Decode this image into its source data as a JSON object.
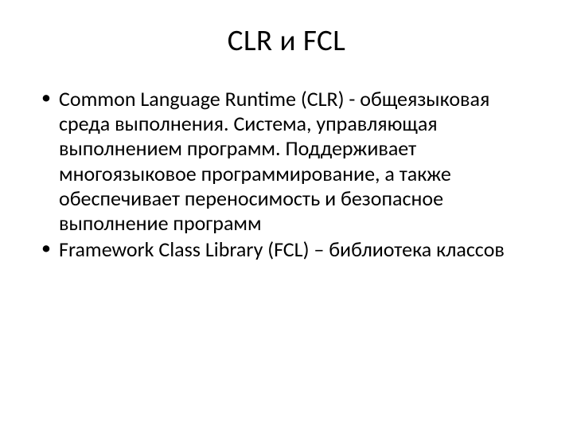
{
  "title": "CLR и FCL",
  "bullets": [
    "Common Language Runtime (CLR) - общеязыковая среда выполнения. Система, управляющая выполнением программ. Поддерживает многоязыковое программирование, а также обеспечивает переносимость и безопасное выполнение программ",
    "Framework Class Library (FCL) – библиотека классов"
  ]
}
